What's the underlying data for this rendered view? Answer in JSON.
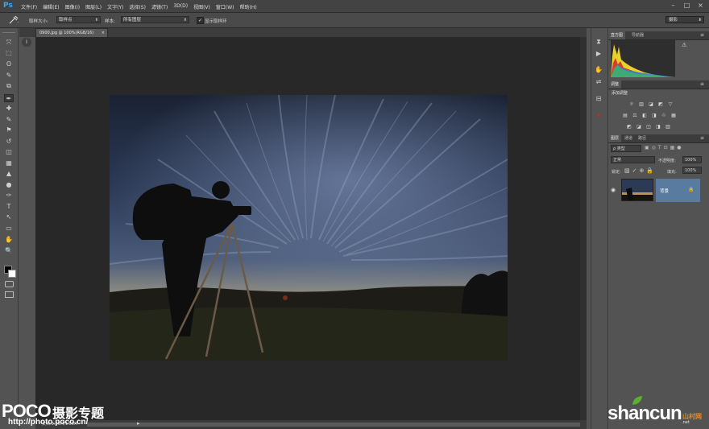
{
  "app": {
    "logo": "Ps",
    "menu": [
      "文件(F)",
      "编辑(E)",
      "图像(I)",
      "图层(L)",
      "文字(Y)",
      "选择(S)",
      "滤镜(T)",
      "3D(D)",
      "视图(V)",
      "窗口(W)",
      "帮助(H)"
    ],
    "window_buttons": [
      "–",
      "□",
      "×"
    ]
  },
  "options_bar": {
    "tool_icon": "eyedropper-icon",
    "sample_size_label": "取样大小:",
    "sample_size_value": "取样点",
    "sample_label": "样本:",
    "sample_value": "所有图层",
    "show_ring_label": "显示取样环",
    "show_ring_checked": true,
    "workspace": "摄影"
  },
  "document": {
    "tab_title": "0900.jpg @ 100%(RGB/16)",
    "tab_close": "×",
    "status_text": "文档:1.09M/1.09M",
    "status_arrow": "▸"
  },
  "tools": [
    "move-tool-icon",
    "marquee-tool-icon",
    "lasso-tool-icon",
    "quick-select-icon",
    "crop-icon",
    "eyedropper-icon",
    "healing-brush-icon",
    "brush-icon",
    "clone-stamp-icon",
    "history-brush-icon",
    "eraser-icon",
    "gradient-icon",
    "blur-icon",
    "dodge-icon",
    "pen-icon",
    "type-icon",
    "path-select-icon",
    "rectangle-icon",
    "hand-icon",
    "zoom-icon"
  ],
  "tool_glyphs": [
    "⤧",
    "⬚",
    "ʘ",
    "✎",
    "⧉",
    "✒",
    "✚",
    "✎",
    "⚑",
    "↺",
    "◫",
    "▦",
    "▲",
    "●",
    "✑",
    "T",
    "↖",
    "▭",
    "✋",
    "🔍"
  ],
  "panels": {
    "histogram_tabs": [
      "直方图",
      "导航器"
    ],
    "adjustments_tab": "调整",
    "adjustments_title": "添加调整",
    "adjustment_icons_row1": [
      "☼",
      "▥",
      "◪",
      "◩",
      "▽"
    ],
    "adjustment_icons_row2": [
      "▤",
      "⚖",
      "◧",
      "◨",
      "♲",
      "▦"
    ],
    "adjustment_icons_row3": [
      "◩",
      "◪",
      "◫",
      "◨",
      "▥"
    ],
    "layers_tabs": [
      "图层",
      "通道",
      "路径"
    ],
    "layers_kind": "ρ 类型",
    "blend_mode": "正常",
    "opacity_label": "不透明度:",
    "opacity_value": "100%",
    "lock_label": "锁定:",
    "fill_label": "填充:",
    "fill_value": "100%",
    "layer_name": "背景"
  },
  "dock_icons": [
    "history-icon",
    "play-icon",
    "hand-tool-icon",
    "adjust-icon",
    "plugin-icon",
    "close-red-icon"
  ],
  "watermarks": {
    "poco": "POCO",
    "poco_cn": "摄影专题",
    "poco_url": "http://photo.poco.cn/",
    "shancun": "shancun",
    "shancun_cn": "山村网",
    "shancun_url": ".net"
  },
  "colors": {
    "accent_blue": "#31a8ff",
    "selected_layer": "#5a7ba0",
    "close_red": "#d9261c",
    "shancun_orange": "#f08a1c",
    "leaf_green": "#5bb12f"
  }
}
